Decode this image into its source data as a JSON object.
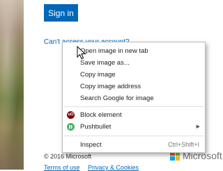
{
  "page": {
    "signin_label": "Sign in",
    "access_link": "Can't access your account?",
    "copyright": "© 2016 Microsoft",
    "terms_link": "Terms of use",
    "privacy_link": "Privacy & Cookies",
    "brand_name": "Microsoft",
    "brand_colors": [
      "#f25022",
      "#7fba00",
      "#00a4ef",
      "#ffb900"
    ],
    "accent_color": "#0067b8"
  },
  "context_menu": {
    "items": [
      {
        "label": "Open image in new tab"
      },
      {
        "label": "Save image as..."
      },
      {
        "label": "Copy image"
      },
      {
        "label": "Copy image address"
      },
      {
        "label": "Search Google for image"
      },
      {
        "label": "Block element",
        "icon": "ublock-icon",
        "icon_text": "uO",
        "icon_color": "#800000"
      },
      {
        "label": "Pushbullet",
        "icon": "pushbullet-icon",
        "icon_color": "#4ab367",
        "submenu_arrow": "▶"
      },
      {
        "label": "Inspect",
        "shortcut": "Ctrl+Shift+I"
      }
    ]
  }
}
